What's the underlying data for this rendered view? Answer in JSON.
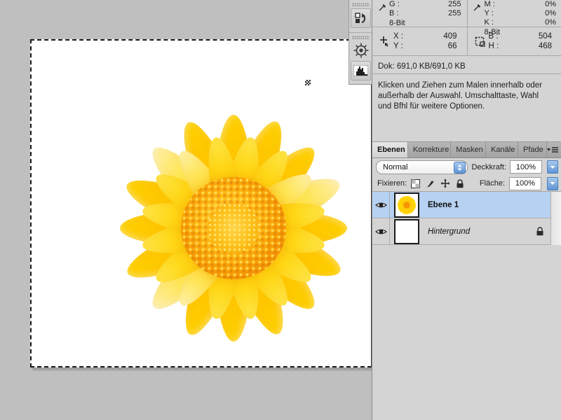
{
  "info_panel": {
    "readouts": [
      {
        "icon": "eyedropper-icon",
        "rows": [
          {
            "label": "G :",
            "value": "255"
          },
          {
            "label": "B :",
            "value": "255"
          }
        ],
        "depth": "8-Bit"
      },
      {
        "icon": "eyedropper-cmyk-icon",
        "rows": [
          {
            "label": "M :",
            "value": "0%"
          },
          {
            "label": "Y :",
            "value": "0%"
          },
          {
            "label": "K :",
            "value": "0%"
          }
        ],
        "depth": "8-Bit"
      }
    ],
    "coords": {
      "pointer_icon": "crosshair-pointer-icon",
      "x_label": "X :",
      "x_value": "409",
      "y_label": "Y :",
      "y_value": "66",
      "marquee_icon": "marquee-size-icon",
      "w_label": "B :",
      "w_value": "504",
      "h_label": "H :",
      "h_value": "468"
    },
    "doc_size": "Dok: 691,0 KB/691,0 KB",
    "hint": "Klicken und Ziehen zum Malen innerhalb oder außerhalb der Auswahl. Umschalttaste, Wahl und Bfhl für weitere Optionen."
  },
  "dock": {
    "buttons": [
      {
        "icon": "history-actions-icon"
      },
      {
        "icon": "navigator-icon"
      },
      {
        "icon": "histogram-icon"
      }
    ]
  },
  "layers_panel": {
    "tabs": [
      {
        "label": "Ebenen",
        "active": true
      },
      {
        "label": "Korrekture",
        "active": false
      },
      {
        "label": "Masken",
        "active": false
      },
      {
        "label": "Kanäle",
        "active": false
      },
      {
        "label": "Pfade",
        "active": false
      }
    ],
    "menu_icon": "panel-menu-icon",
    "blend_mode": "Normal",
    "opacity_label": "Deckkraft:",
    "opacity_value": "100%",
    "lock_label": "Fixieren:",
    "lock_icons": [
      "lock-transparency-icon",
      "lock-image-pixels-icon",
      "lock-position-icon",
      "lock-all-icon"
    ],
    "fill_label": "Fläche:",
    "fill_value": "100%",
    "layers": [
      {
        "name": "Ebene 1",
        "visible": true,
        "selected": true,
        "locked": false,
        "style": "bold",
        "thumb": "flower-thumbnail"
      },
      {
        "name": "Hintergrund",
        "visible": true,
        "selected": false,
        "locked": true,
        "style": "italic",
        "thumb": "white-thumbnail"
      }
    ]
  },
  "canvas": {
    "artwork": "yellow-calendula-flower",
    "selection": "marching-ants-selection",
    "cursor_mark": "brush-cursor-mark"
  },
  "colors": {
    "panel_bg": "#d4d4d4",
    "workspace_bg": "#bfbfbf",
    "selection_blue": "#b6d1f2",
    "petal_yellow": "#ffd000",
    "disc_orange": "#f49700"
  }
}
